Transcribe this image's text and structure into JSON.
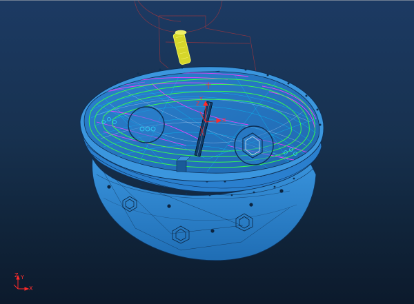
{
  "viewport": {
    "background_top": "#1c3a63",
    "background_bottom": "#0c1a2c",
    "part_color": "#2f86d3",
    "part_edge_color": "#0d2f55",
    "toolpath_colors": [
      "#ff3cff",
      "#39ff4a",
      "#ffffff",
      "#00d0ff"
    ],
    "tool_color": "#ffff66",
    "triad_color": "#ff2a2a"
  },
  "workplane_triad": {
    "x_label": "X",
    "y_label": "Y",
    "z_label": "Z"
  },
  "view_triad": {
    "x_label": "X",
    "y_label": "Y",
    "z_label": "Z"
  }
}
